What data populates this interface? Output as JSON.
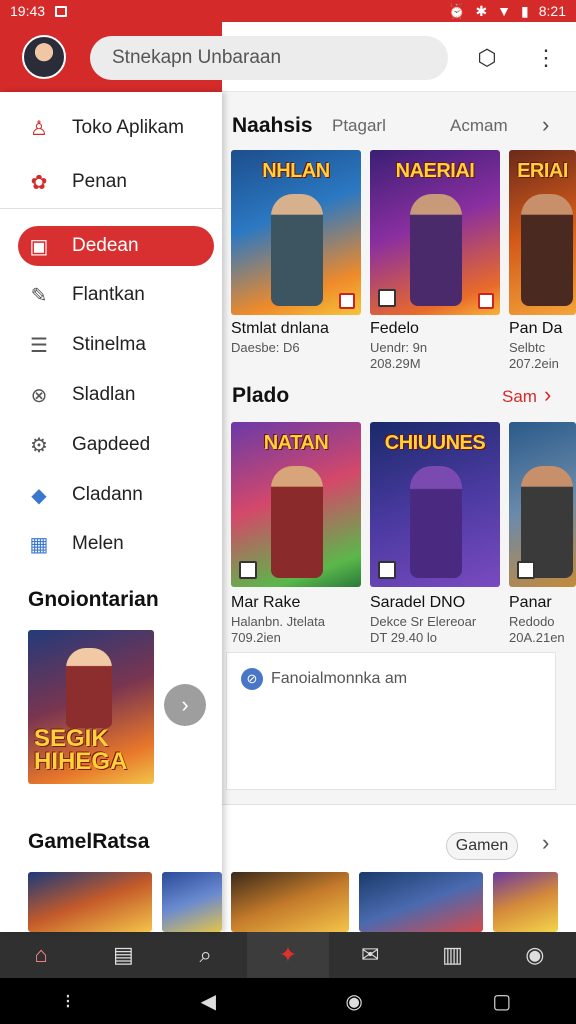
{
  "status": {
    "time": "19:43",
    "battery": "8:21"
  },
  "topbar": {
    "search_placeholder": "Stnekapn Unbaraan"
  },
  "drawer": {
    "items": [
      {
        "label": "Toko Aplikam",
        "icon": "bag-icon"
      },
      {
        "label": "Penan",
        "icon": "flower-icon"
      },
      {
        "label": "Dedean",
        "icon": "card-icon",
        "active": true
      },
      {
        "label": "Flantkan",
        "icon": "pen-icon"
      },
      {
        "label": "Stinelma",
        "icon": "list-icon"
      },
      {
        "label": "Sladlan",
        "icon": "shield-icon"
      },
      {
        "label": "Gapdeed",
        "icon": "wrench-icon"
      },
      {
        "label": "Cladann",
        "icon": "badge-icon"
      },
      {
        "label": "Melen",
        "icon": "calendar-icon"
      }
    ],
    "promo_heading": "Gnoiontarian",
    "promo_text": "SEGIK HIHEGA",
    "bottom_heading": "GamelRatsa"
  },
  "main": {
    "section1": {
      "title": "Naahsis",
      "tabs": [
        "Ptagarl",
        "Acmam"
      ],
      "cards": [
        {
          "image_title": "NHLAN",
          "name": "Stmlat dnlana",
          "meta1": "Daesbe: D6",
          "meta2": ""
        },
        {
          "image_title": "NAERIAI",
          "name": "Fedelo",
          "meta1": "Uendr: 9n",
          "meta2": "208.29M"
        },
        {
          "image_title": "ERIAI",
          "name": "Pan Da",
          "meta1": "Selbtc",
          "meta2": "207.2ein"
        }
      ]
    },
    "section2": {
      "title": "Plado",
      "see_all": "Sam",
      "cards": [
        {
          "image_title": "NATAN",
          "name": "Mar Rake",
          "meta1": "Halanbn. Jtelata",
          "meta2": "709.2ien"
        },
        {
          "image_title": "CHIUUNES",
          "name": "Saradel DNO",
          "meta1": "Dekce Sr Elereoar",
          "meta2": "DT 29.40 lo"
        },
        {
          "image_title": "",
          "name": "Panar",
          "meta1": "Redodo",
          "meta2": "20A.21en"
        }
      ]
    },
    "notice": "Fanoialmonnka am",
    "games_pill": "Gamen"
  }
}
